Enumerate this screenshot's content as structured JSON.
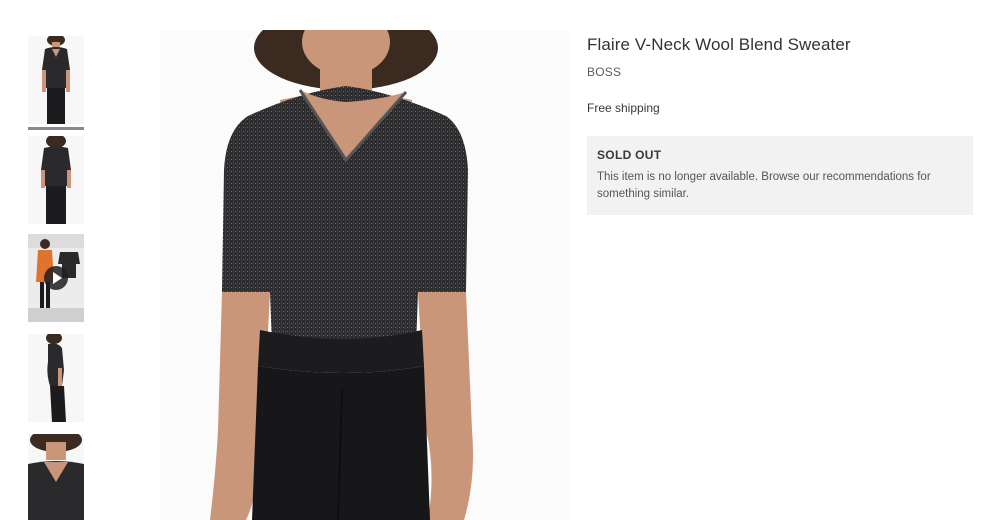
{
  "product": {
    "title": "Flaire V-Neck Wool Blend Sweater",
    "brand": "BOSS",
    "shipping": "Free shipping"
  },
  "availability": {
    "status_label": "SOLD OUT",
    "message": "This item is no longer available. Browse our recommendations for something similar."
  },
  "gallery": {
    "selected_index": 0,
    "thumbnails": [
      {
        "view": "front"
      },
      {
        "view": "back"
      },
      {
        "view": "video",
        "icon": "play-icon"
      },
      {
        "view": "side"
      },
      {
        "view": "detail"
      }
    ]
  },
  "colors": {
    "sold_out_bg": "#f2f2f2",
    "indicator": "#8a8a8a",
    "sweater": "#2a2a2c",
    "skin": "#c99679"
  }
}
